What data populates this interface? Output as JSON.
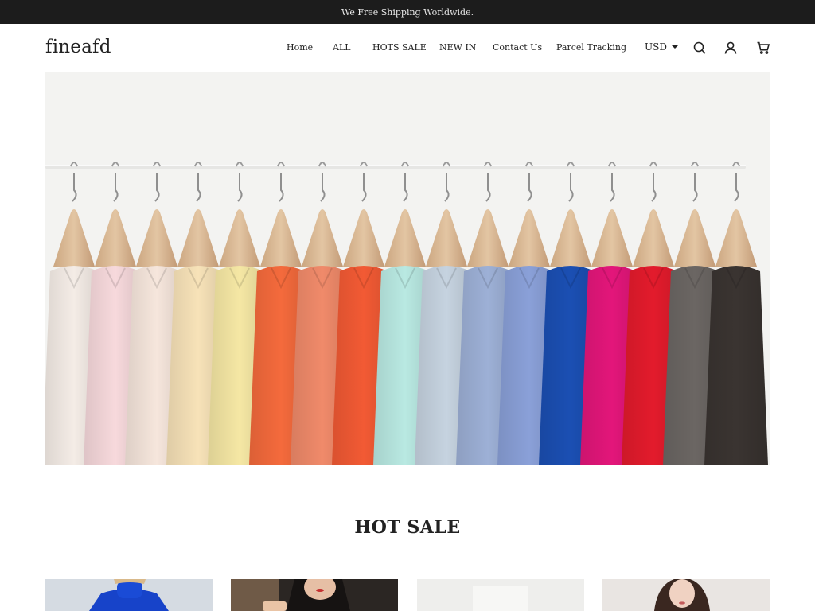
{
  "announcement": {
    "text": "We Free Shipping Worldwide."
  },
  "header": {
    "logo": "fineafd",
    "nav": [
      {
        "label": "Home"
      },
      {
        "label": "ALL"
      },
      {
        "label": "HOTS SALE"
      },
      {
        "label": "NEW IN"
      },
      {
        "label": "Contact Us"
      },
      {
        "label": "Parcel Tracking"
      }
    ],
    "currency": "USD",
    "icons": [
      "search-icon",
      "account-icon",
      "cart-icon"
    ]
  },
  "hero": {
    "image": "clothes-on-rack"
  },
  "hot_sale": {
    "title": "HOT SALE",
    "products": [
      {
        "image": "blue-turtleneck"
      },
      {
        "image": "woman-dark-hair"
      },
      {
        "image": "light-garment"
      },
      {
        "image": "woman-portrait"
      }
    ]
  },
  "colors": {
    "announce_bg": "#1c1c1c",
    "text": "#222222"
  }
}
